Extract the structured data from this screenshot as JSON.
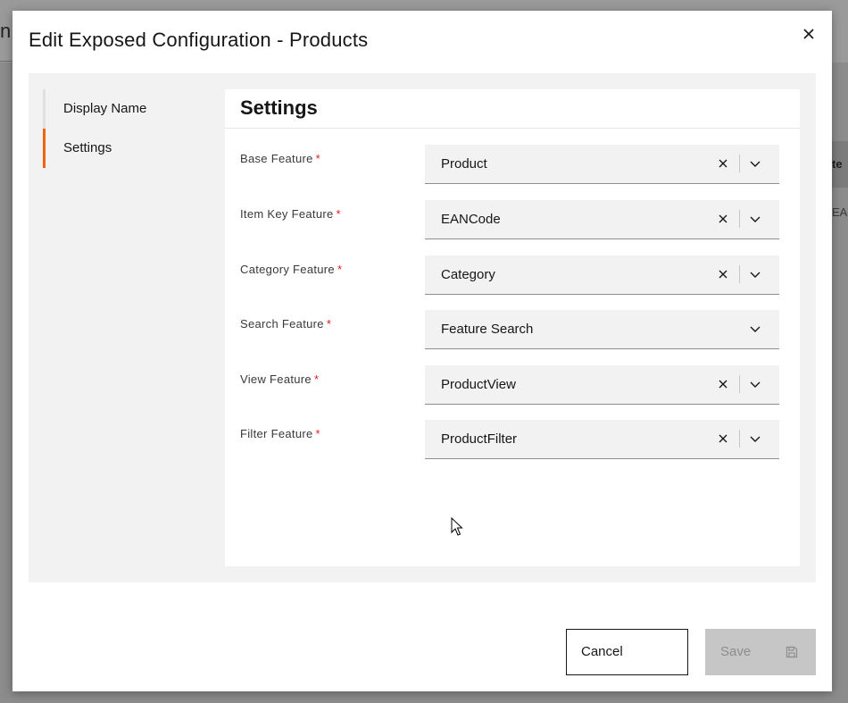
{
  "background": {
    "partial_title": "n",
    "partial_header": "te",
    "partial_cell": "EAN"
  },
  "modal": {
    "title": "Edit Exposed Configuration - Products",
    "close_icon": "close-icon"
  },
  "nav": {
    "items": [
      {
        "label": "Display Name",
        "active": false
      },
      {
        "label": "Settings",
        "active": true
      }
    ]
  },
  "panel": {
    "title": "Settings",
    "required_marker": "*",
    "fields": [
      {
        "label": "Base Feature",
        "value": "Product",
        "clearable": true
      },
      {
        "label": "Item Key Feature",
        "value": "EANCode",
        "clearable": true
      },
      {
        "label": "Category Feature",
        "value": "Category",
        "clearable": true
      },
      {
        "label": "Search Feature",
        "value": "Feature Search",
        "clearable": false
      },
      {
        "label": "View Feature",
        "value": "ProductView",
        "clearable": true
      },
      {
        "label": "Filter Feature",
        "value": "ProductFilter",
        "clearable": true
      }
    ]
  },
  "footer": {
    "cancel_label": "Cancel",
    "save_label": "Save",
    "save_icon": "save-icon",
    "save_disabled": true
  },
  "colors": {
    "accent": "#f1620c",
    "required": "#da1e28",
    "disabled_bg": "#c6c6c6"
  }
}
